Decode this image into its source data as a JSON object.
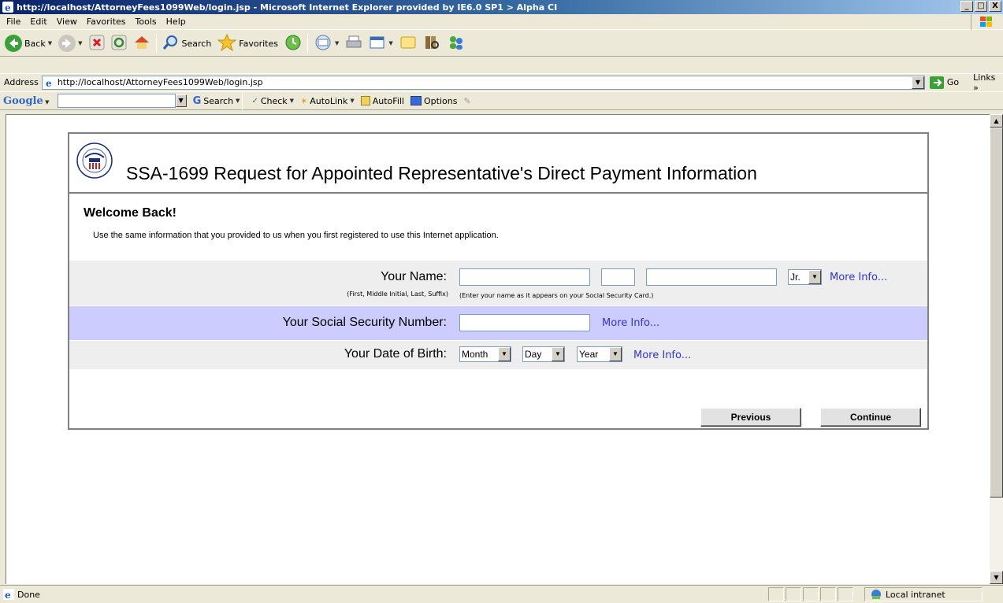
{
  "window": {
    "title": "http://localhost/AttorneyFees1099Web/login.jsp - Microsoft Internet Explorer provided by IE6.0 SP1 > Alpha CI",
    "minimize": "_",
    "maximize": "□",
    "close": "X"
  },
  "menu": {
    "items": [
      "File",
      "Edit",
      "View",
      "Favorites",
      "Tools",
      "Help"
    ]
  },
  "toolbar": {
    "back_label": "Back",
    "search_label": "Search",
    "favorites_label": "Favorites"
  },
  "address": {
    "label": "Address",
    "url": "http://localhost/AttorneyFees1099Web/login.jsp",
    "go_label": "Go",
    "links_label": "Links »"
  },
  "google": {
    "logo": "Google",
    "search_label": "Search",
    "check_label": "Check",
    "autolink_label": "AutoLink",
    "autofill_label": "AutoFill",
    "options_label": "Options"
  },
  "page": {
    "title": "SSA-1699 Request for Appointed Representative's Direct Payment Information",
    "welcome": "Welcome Back!",
    "intro": "Use the same information that you provided to us when you first registered to use this Internet application.",
    "name_label": "Your Name:",
    "name_hint_left": "(First, Middle Initial, Last, Suffix)",
    "name_hint_right": "(Enter your name as it appears on your Social Security Card.)",
    "suffix_value": "Jr.",
    "ssn_label": "Your Social Security Number:",
    "dob_label": "Your Date of Birth:",
    "month_value": "Month",
    "day_value": "Day",
    "year_value": "Year",
    "more_info": "More Info...",
    "previous_label": "Previous",
    "continue_label": "Continue"
  },
  "status": {
    "text": "Done",
    "zone": "Local intranet"
  },
  "colors": {
    "ssn_row": "#ccccff",
    "alt_row": "#eeeeee",
    "link": "#3333cc"
  }
}
